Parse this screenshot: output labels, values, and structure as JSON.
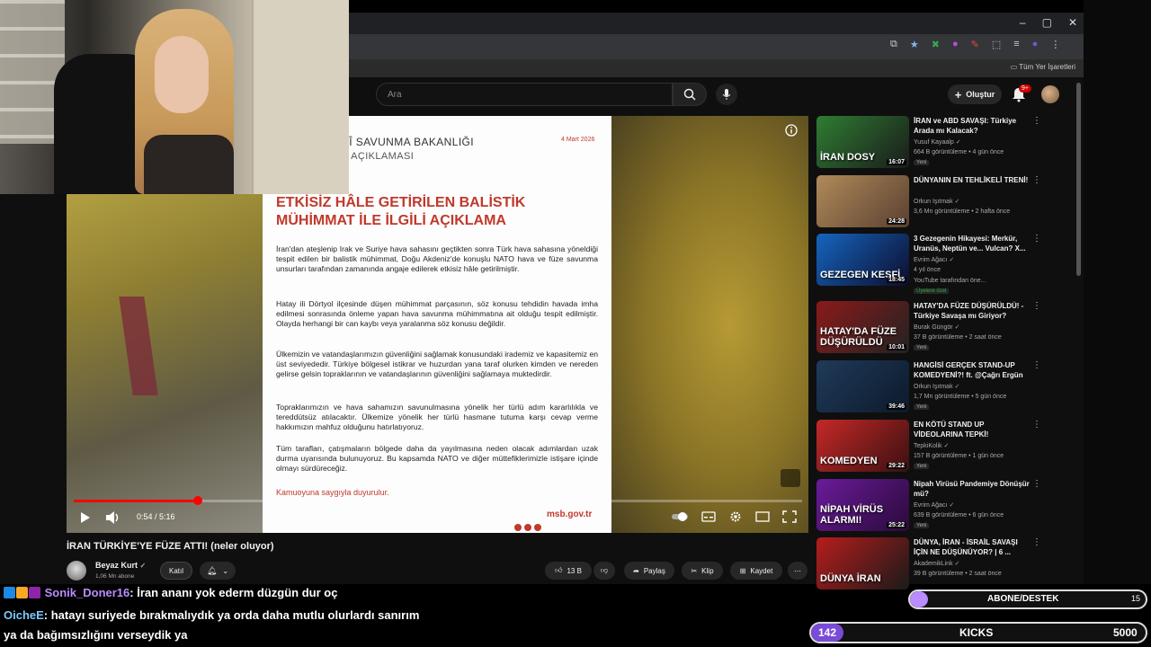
{
  "browser": {
    "bookmarks_label": "Tüm Yer İşaretleri",
    "window_controls": [
      "–",
      "▢",
      "✕"
    ]
  },
  "youtube_header": {
    "search_placeholder": "Ara",
    "create_label": "Oluştur",
    "notifications_badge": "9+"
  },
  "player": {
    "document": {
      "ministry": "MİLLÎ SAVUNMA BAKANLIĞI",
      "subtitle": "ASIN AÇIKLAMASI",
      "date": "4 Mart 2026",
      "title": "ETKİSİZ HÂLE GETİRİLEN BALİSTİK MÜHİMMAT İLE İLGİLİ AÇIKLAMA",
      "paragraphs": [
        "İran'dan ateşlenip Irak ve Suriye hava sahasını geçtikten sonra Türk hava sahasına yöneldiği tespit edilen bir balistik mühimmat, Doğu Akdeniz'de konuşlu NATO hava ve füze savunma unsurları tarafından zamanında angaje edilerek etkisiz hâle getirilmiştir.",
        "Hatay ili Dörtyol ilçesinde düşen mühimmat parçasının, söz konusu tehdidin havada imha edilmesi sonrasında önleme yapan hava savunma mühimmatına ait olduğu tespit edilmiştir. Olayda herhangi bir can kaybı veya yaralanma söz konusu değildir.",
        "Ülkemizin ve vatandaşlarımızın güvenliğini sağlamak konusundaki irademiz ve kapasitemiz en üst seviyededir. Türkiye bölgesel istikrar ve huzurdan yana taraf olurken kimden ve nereden gelirse gelsin topraklarının ve vatandaşlarının güvenliğini sağlamaya muktedirdir.",
        "Topraklarımızın ve hava sahamızın savunulmasına yönelik her türlü adım kararlılıkla ve tereddütsüz atılacaktır. Ülkemize yönelik her türlü hasmane tutuma karşı cevap verme hakkımızın mahfuz olduğunu hatırlatıyoruz.",
        "Tüm tarafları, çatışmaların bölgede daha da yayılmasına neden olacak adımlardan uzak durma uyarısında bulunuyoruz. Bu kapsamda NATO ve diğer müttefiklerimizle istişare içinde olmayı sürdüreceğiz."
      ],
      "signoff": "Kamuoyuna saygıyla duyurulur.",
      "website": "msb.gov.tr"
    },
    "time": "0:54 / 5:16",
    "progress_fraction": 0.17
  },
  "video": {
    "title": "İRAN TÜRKİYE'YE FÜZE ATTI! (neler oluyor)",
    "channel": "Beyaz Kurt",
    "subscribers": "1,06 Mn abone",
    "join_label": "Katıl",
    "likes": "13 B",
    "share_label": "Paylaş",
    "clip_label": "Klip",
    "save_label": "Kaydet"
  },
  "recommendations": [
    {
      "title": "İRAN ve ABD SAVAŞI: Türkiye Arada mı Kalacak?",
      "channel": "Yusuf Kayaalp",
      "meta": "664 B görüntüleme • 4 gün önce",
      "badge": "Yeni",
      "duration": "16:07",
      "thumb_text": "İRAN DOSY",
      "colors": [
        "#2e7d32",
        "#1b1b1b"
      ]
    },
    {
      "title": "DÜNYANIN EN TEHLİKELİ TRENİ!",
      "channel": "Orkun Işıtmak",
      "meta": "3,6 Mn görüntüleme • 2 hafta önce",
      "badge": "",
      "duration": "24:28",
      "thumb_text": "",
      "colors": [
        "#b08a5a",
        "#5a4030"
      ]
    },
    {
      "title": "3 Gezegenin Hikayesi: Merkür, Uranüs, Neptün ve... Vulcan? X...",
      "channel": "Evrim Ağacı",
      "meta": "4 yıl önce",
      "badge": "Üyelere özel",
      "extra": "YouTube tarafından öne...",
      "duration": "18:45",
      "thumb_text": "GEZEGEN KEŞFİ",
      "colors": [
        "#1565c0",
        "#0d0d2b"
      ]
    },
    {
      "title": "HATAY'DA FÜZE DÜŞÜRÜLDÜ! - Türkiye Savaşa mı Giriyor?",
      "channel": "Burak Güngör",
      "meta": "37 B görüntüleme • 2 saat önce",
      "badge": "Yeni",
      "duration": "10:01",
      "thumb_text": "HATAY'DA FÜZE DÜŞÜRÜLDÜ",
      "colors": [
        "#8b1a1a",
        "#222"
      ]
    },
    {
      "title": "HANGİSİ GERÇEK STAND-UP KOMEDYENİ?! ft. @Çağrı Ergün",
      "channel": "Orkun Işıtmak",
      "meta": "1,7 Mn görüntüleme • 5 gün önce",
      "badge": "Yeni",
      "duration": "39:46",
      "thumb_text": "",
      "colors": [
        "#1f3a5a",
        "#0d1a2a"
      ]
    },
    {
      "title": "EN KÖTÜ STAND UP VİDEOLARINA TEPKİ!",
      "channel": "TepkiKolik",
      "meta": "157 B görüntüleme • 1 gün önce",
      "badge": "Yeni",
      "duration": "29:22",
      "thumb_text": "KOMEDYEN",
      "colors": [
        "#c62828",
        "#3a1010"
      ]
    },
    {
      "title": "Nipah Virüsü Pandemiye Dönüşür mü?",
      "channel": "Evrim Ağacı",
      "meta": "639 B görüntüleme • 6 gün önce",
      "badge": "Yeni",
      "duration": "25:22",
      "thumb_text": "NİPAH VİRÜS ALARMI!",
      "colors": [
        "#6a1b9a",
        "#2a0a3a"
      ]
    },
    {
      "title": "DÜNYA, İRAN - İSRAİL SAVAŞI İÇİN NE DÜŞÜNÜYOR? | 6 ...",
      "channel": "AkademikLink",
      "meta": "39 B görüntüleme • 2 saat önce",
      "badge": "",
      "duration": "",
      "thumb_text": "DÜNYA İRAN",
      "colors": [
        "#b71c1c",
        "#1a1a1a"
      ]
    }
  ],
  "chat": {
    "line1_user": "Sonik_Doner16",
    "line1_text": ": İran ananı yok ederm düzgün dur oç",
    "line2_user": "OicheE",
    "line2_text": ": hatayı suriyede bırakmalıydık ya orda daha mutlu olurlardı sanırım",
    "line3_text": "ya da bağımsızlığını verseydik ya"
  },
  "overlay": {
    "abone_label": "ABONE/DESTEK",
    "abone_count": "15",
    "kicks_label": "KICKS",
    "kicks_current": "142",
    "kicks_goal": "5000"
  },
  "colors": {
    "accent": "#ff0000",
    "doc_red": "#c0392b",
    "kicks_purple": "#7a4bd6"
  }
}
